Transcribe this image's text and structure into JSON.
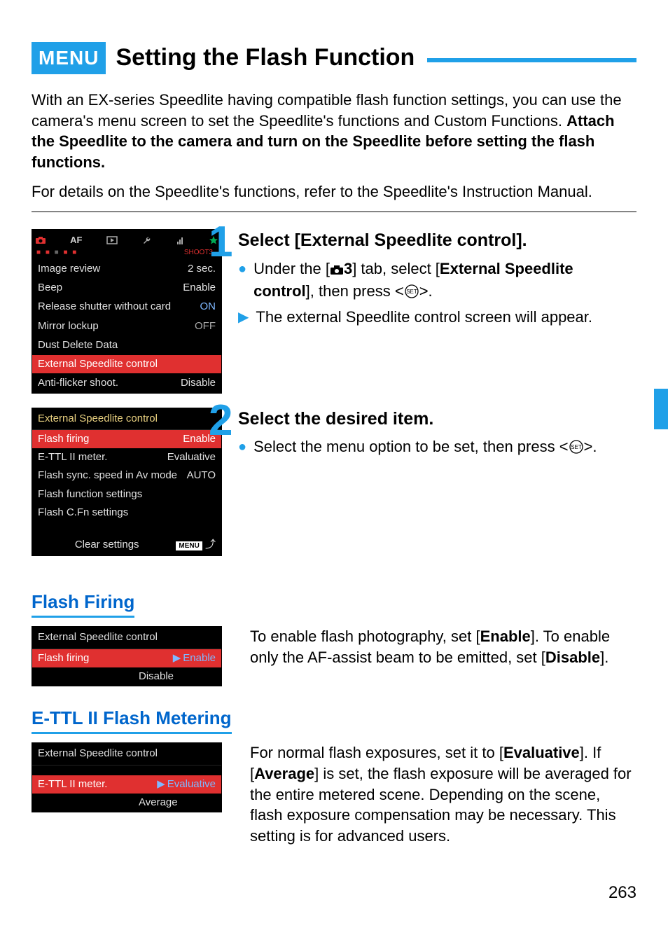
{
  "header": {
    "badge": "MENU",
    "title": "Setting the Flash Function"
  },
  "intro": {
    "p1": "With an EX-series Speedlite having compatible flash function settings, you can use the camera's menu screen to set the Speedlite's functions and Custom Functions. ",
    "p1b": "Attach the Speedlite to the camera and turn on the Speedlite before setting the flash functions.",
    "p2": "For details on the Speedlite's functions, refer to the Speedlite's Instruction Manual."
  },
  "step1": {
    "num": "1",
    "title": "Select [External Speedlite control].",
    "b1a": "Under the [",
    "b1b": "3",
    "b1c": "] tab, select [",
    "b1d": "External Speedlite control",
    "b1e": "], then press <",
    "b1f": ">.",
    "b2": "The external Speedlite control screen will appear."
  },
  "step2": {
    "num": "2",
    "title": "Select the desired item.",
    "b1a": "Select the menu option to be set, then press <",
    "b1b": ">."
  },
  "lcd1": {
    "shoot": "SHOOT3",
    "rows": {
      "r1l": "Image review",
      "r1v": "2 sec.",
      "r2l": "Beep",
      "r2v": "Enable",
      "r3l": "Release shutter without card",
      "r3v": "ON",
      "r4l": "Mirror lockup",
      "r4v": "OFF",
      "r5l": "Dust Delete Data",
      "r6l": "External Speedlite control",
      "r7l": "Anti-flicker shoot.",
      "r7v": "Disable"
    }
  },
  "lcd2": {
    "header": "External Speedlite control",
    "rows": {
      "r1l": "Flash firing",
      "r1v": "Enable",
      "r2l": "E-TTL II meter.",
      "r2v": "Evaluative",
      "r3l": "Flash sync. speed in Av mode",
      "r3v": "AUTO",
      "r4l": "Flash function settings",
      "r5l": "Flash C.Fn settings",
      "clear": "Clear settings",
      "menu": "MENU"
    }
  },
  "flashFiring": {
    "heading": "Flash Firing",
    "lcdHeader": "External Speedlite control",
    "row1l": "Flash firing",
    "opt1": "Enable",
    "opt2": "Disable",
    "text1": "To enable flash photography, set [",
    "text2": "Enable",
    "text3": "]. To enable only the AF-assist beam to be emitted, set [",
    "text4": "Disable",
    "text5": "]."
  },
  "ettl": {
    "heading": "E-TTL II Flash Metering",
    "lcdHeader": "External Speedlite control",
    "row1l": "E-TTL II meter.",
    "opt1": "Evaluative",
    "opt2": "Average",
    "text1": "For normal flash exposures, set it to [",
    "text2": "Evaluative",
    "text3": "]. If [",
    "text4": "Average",
    "text5": "] is set, the flash exposure will be averaged for the entire metered scene. Depending on the scene, flash exposure compensation may be necessary. This setting is for advanced users."
  },
  "pagenum": "263"
}
